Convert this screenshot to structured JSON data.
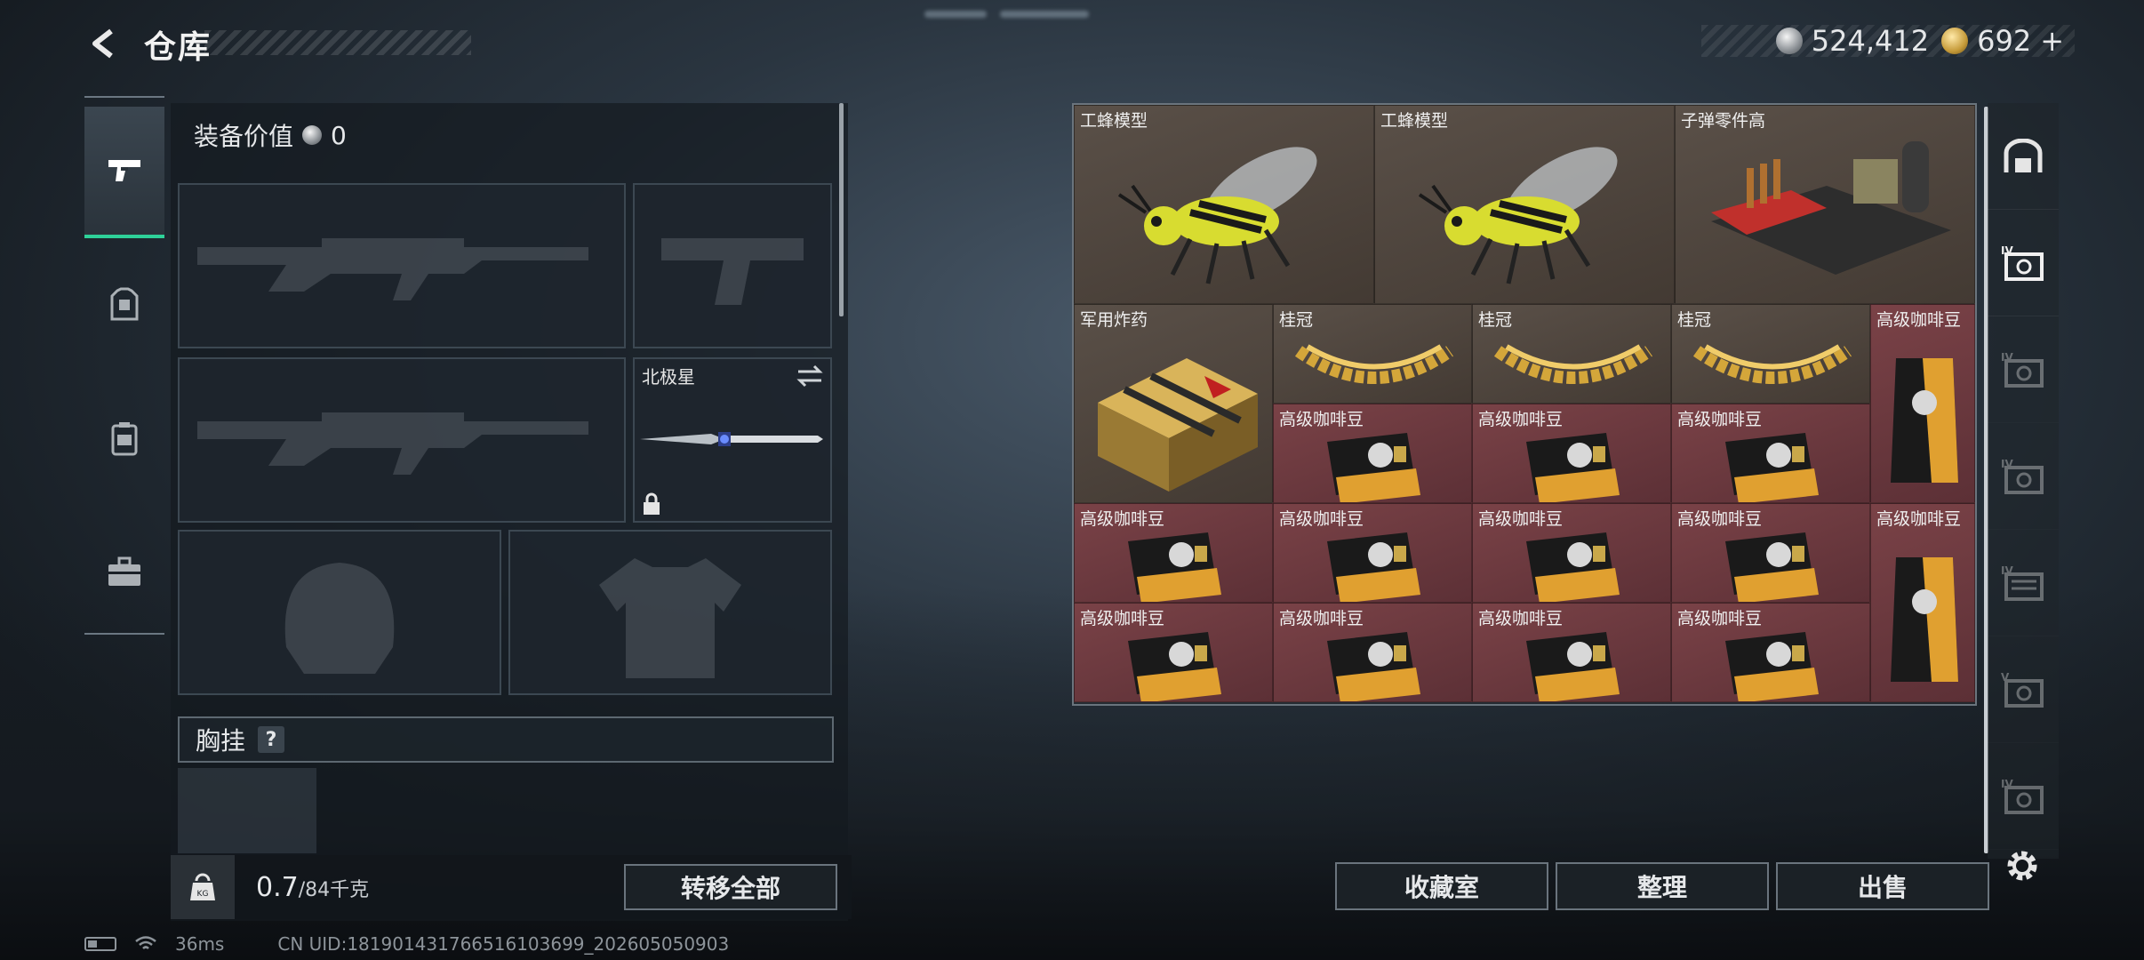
{
  "header": {
    "title": "仓库"
  },
  "currency": {
    "silver": "524,412",
    "gold": "692",
    "gold_plus": "+"
  },
  "equipment": {
    "value_label": "装备价值",
    "value": "0",
    "melee_slot_label": "北极星",
    "chest_rig_label": "胸挂",
    "chest_rig_help": "?"
  },
  "weight": {
    "current": "0.7",
    "max": "/84千克",
    "transfer_all": "转移全部"
  },
  "stash_items": [
    {
      "label": "工蜂模型",
      "type": "bee"
    },
    {
      "label": "工蜂模型",
      "type": "bee"
    },
    {
      "label": "子弹零件高",
      "type": "ammo-kit"
    },
    {
      "label": "军用炸药",
      "type": "explosive"
    },
    {
      "label": "桂冠",
      "type": "laurel"
    },
    {
      "label": "桂冠",
      "type": "laurel"
    },
    {
      "label": "桂冠",
      "type": "laurel"
    },
    {
      "label": "高级咖啡豆",
      "type": "coffee-tall"
    },
    {
      "label": "高级咖啡豆",
      "type": "coffee"
    },
    {
      "label": "高级咖啡豆",
      "type": "coffee"
    },
    {
      "label": "高级咖啡豆",
      "type": "coffee"
    },
    {
      "label": "高级咖啡豆",
      "type": "coffee"
    },
    {
      "label": "高级咖啡豆",
      "type": "coffee"
    },
    {
      "label": "高级咖啡豆",
      "type": "coffee"
    },
    {
      "label": "高级咖啡豆",
      "type": "coffee"
    },
    {
      "label": "高级咖啡豆",
      "type": "coffee-tall"
    },
    {
      "label": "高级咖啡豆",
      "type": "coffee"
    },
    {
      "label": "高级咖啡豆",
      "type": "coffee"
    },
    {
      "label": "高级咖啡豆",
      "type": "coffee"
    },
    {
      "label": "高级咖啡豆",
      "type": "coffee"
    }
  ],
  "side_tabs": {
    "labels": [
      "IV",
      "IV",
      "IV",
      "IV",
      "V",
      "IV"
    ]
  },
  "actions": {
    "collection": "收藏室",
    "organize": "整理",
    "sell": "出售"
  },
  "status": {
    "ping": "36ms",
    "uid": "CN UID:1819014317665161036​99_202605050903"
  }
}
